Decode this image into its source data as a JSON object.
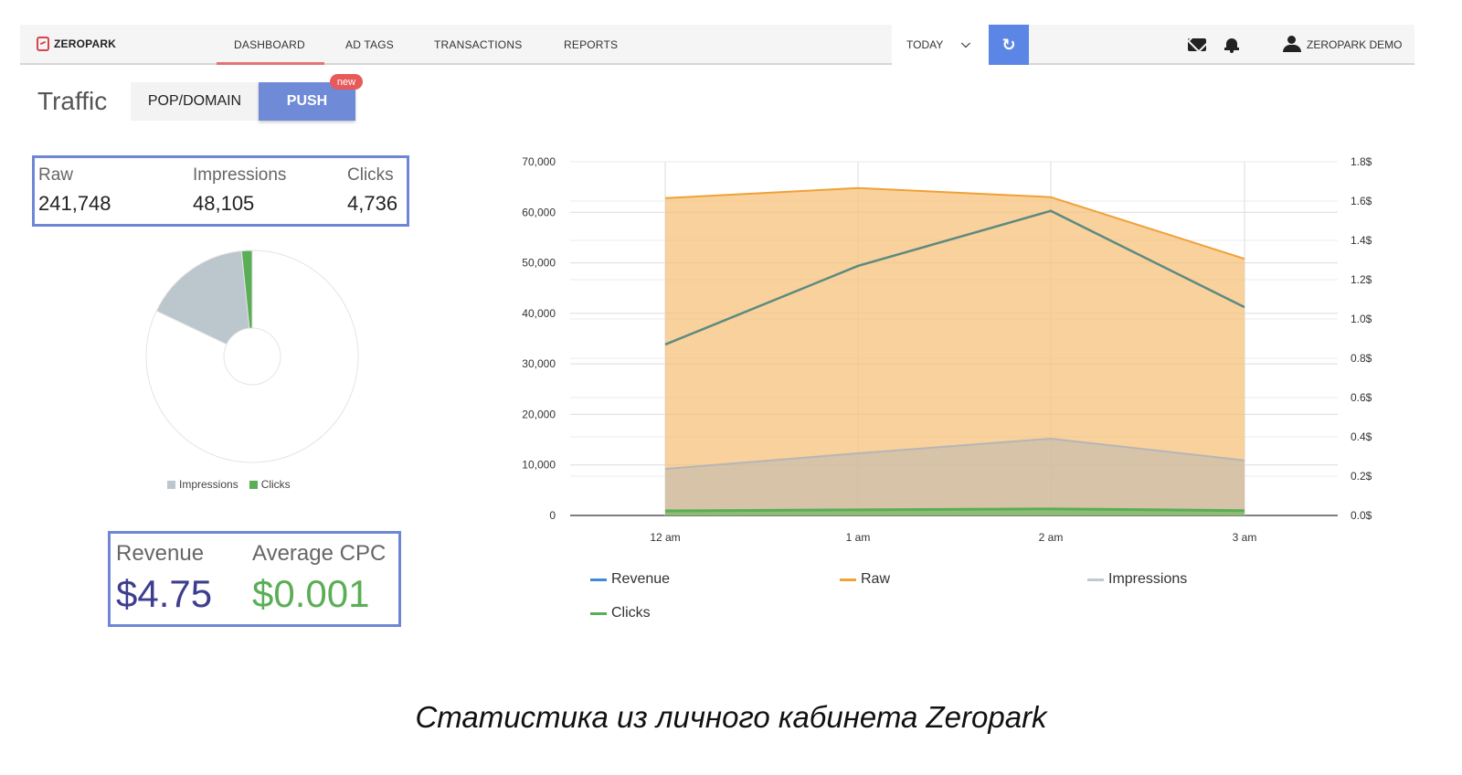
{
  "topbar": {
    "logo": "ZEROPARK",
    "nav": [
      "DASHBOARD",
      "AD TAGS",
      "TRANSACTIONS",
      "REPORTS"
    ],
    "active_nav": "DASHBOARD",
    "date_range": "TODAY",
    "user": "ZEROPARK DEMO",
    "accent_color": "#5b86e5"
  },
  "traffic": {
    "title": "Traffic",
    "tab_pop": "POP/DOMAIN",
    "tab_push": "PUSH",
    "badge": "new"
  },
  "stats": {
    "raw_label": "Raw",
    "raw_value": "241,748",
    "impressions_label": "Impressions",
    "impressions_value": "48,105",
    "clicks_label": "Clicks",
    "clicks_value": "4,736"
  },
  "pie": {
    "legend": [
      {
        "name": "Impressions",
        "color": "#bcc6cd"
      },
      {
        "name": "Clicks",
        "color": "#5aae55"
      }
    ]
  },
  "revenue": {
    "revenue_label": "Revenue",
    "revenue_value": "$4.75",
    "revenue_color": "#3e3e8e",
    "cpc_label": "Average CPC",
    "cpc_value": "$0.001",
    "cpc_color": "#5aae55"
  },
  "chart_data": [
    {
      "type": "pie",
      "values": [
        {
          "name": "Raw",
          "value": 241748,
          "color": "#ffffff"
        },
        {
          "name": "Impressions",
          "value": 48105,
          "color": "#bcc6cd"
        },
        {
          "name": "Clicks",
          "value": 4736,
          "color": "#5aae55"
        }
      ]
    },
    {
      "type": "area",
      "categories": [
        "12 am",
        "1 am",
        "2 am",
        "3 am"
      ],
      "ylim": [
        0,
        70000
      ],
      "yticks": [
        "0",
        "10,000",
        "20,000",
        "30,000",
        "40,000",
        "50,000",
        "60,000",
        "70,000"
      ],
      "y2lim": [
        0,
        1.8
      ],
      "y2ticks": [
        "0.0$",
        "0.2$",
        "0.4$",
        "0.6$",
        "0.8$",
        "1.0$",
        "1.2$",
        "1.4$",
        "1.6$",
        "1.8$"
      ],
      "series": [
        {
          "name": "Revenue",
          "type": "line",
          "axis": "right",
          "color": "#5d8a80",
          "values": [
            0.87,
            1.27,
            1.55,
            1.06
          ]
        },
        {
          "name": "Raw",
          "type": "area",
          "axis": "left",
          "color": "#f0a137",
          "values": [
            62800,
            64800,
            63000,
            50800
          ]
        },
        {
          "name": "Impressions",
          "type": "area",
          "axis": "left",
          "color": "#b6b6b6",
          "values": [
            9200,
            12300,
            15200,
            10900
          ]
        },
        {
          "name": "Clicks",
          "type": "area",
          "axis": "left",
          "color": "#5aae55",
          "values": [
            900,
            1100,
            1300,
            950
          ]
        }
      ],
      "legend": [
        {
          "name": "Revenue",
          "color": "#3d8bd6"
        },
        {
          "name": "Raw",
          "color": "#f0a137"
        },
        {
          "name": "Impressions",
          "color": "#c2c8cc"
        },
        {
          "name": "Clicks",
          "color": "#5aae55"
        }
      ]
    }
  ],
  "caption": "Статистика из личного кабинета Zeropark"
}
